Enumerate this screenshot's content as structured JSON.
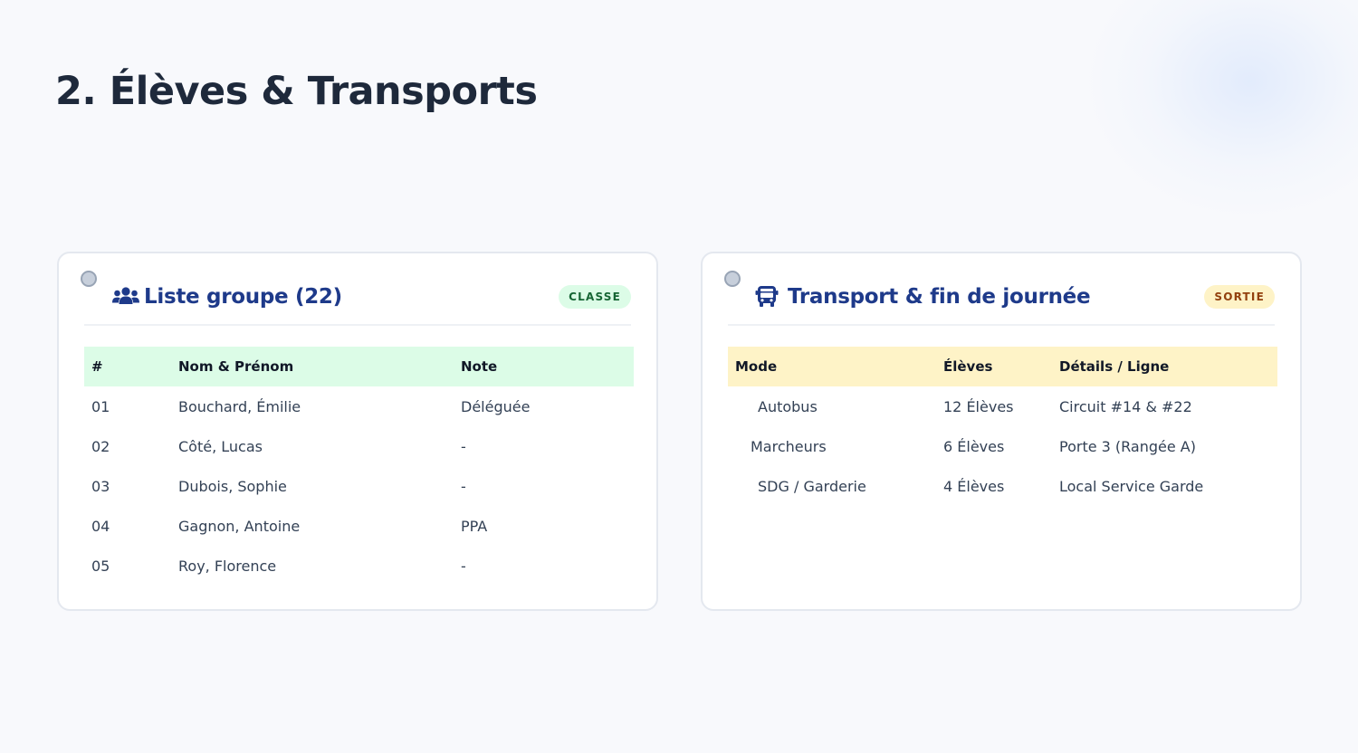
{
  "page": {
    "title": "2. Élèves & Transports"
  },
  "colors": {
    "title": "#1e293b",
    "card_title": "#1e3a8a",
    "green_header": "#dcfce7",
    "yellow_header": "#fef3c7"
  },
  "students_card": {
    "icon": "users-icon",
    "title": "Liste groupe (22)",
    "badge": "CLASSE",
    "columns": [
      "#",
      "Nom & Prénom",
      "Note"
    ],
    "rows": [
      {
        "num": "01",
        "name": "Bouchard, Émilie",
        "note": "Déléguée"
      },
      {
        "num": "02",
        "name": "Côté, Lucas",
        "note": "-"
      },
      {
        "num": "03",
        "name": "Dubois, Sophie",
        "note": "-"
      },
      {
        "num": "04",
        "name": "Gagnon, Antoine",
        "note": "PPA"
      },
      {
        "num": "05",
        "name": "Roy, Florence",
        "note": "-"
      }
    ]
  },
  "transport_card": {
    "icon": "bus-icon",
    "title": "Transport & fin de journée",
    "badge": "SORTIE",
    "columns": [
      "Mode",
      "Élèves",
      "Détails / Ligne"
    ],
    "rows": [
      {
        "mode": "Autobus",
        "count": "12 Élèves",
        "details": "Circuit #14 & #22"
      },
      {
        "mode": "Marcheurs",
        "count": "6 Élèves",
        "details": "Porte 3 (Rangée A)"
      },
      {
        "mode": "SDG / Garderie",
        "count": "4 Élèves",
        "details": "Local Service Garde"
      }
    ]
  }
}
